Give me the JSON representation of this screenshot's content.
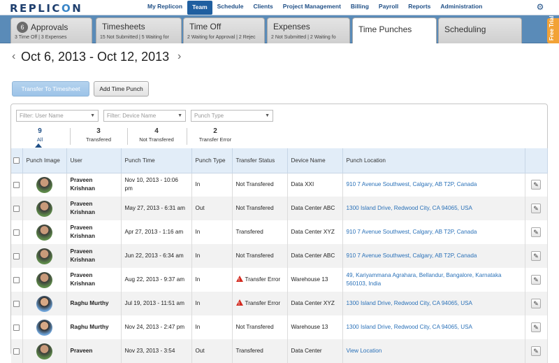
{
  "brand": {
    "logo_prefix": "REPLIC",
    "logo_o": "O",
    "logo_suffix": "N"
  },
  "nav": {
    "items": [
      "My Replicon",
      "Team",
      "Schedule",
      "Clients",
      "Project Management",
      "Billing",
      "Payroll",
      "Reports",
      "Administration"
    ],
    "active": "Team"
  },
  "tabs": [
    {
      "label": "Approvals",
      "badge": "6",
      "sub": "3 Time Off | 3 Expenses"
    },
    {
      "label": "Timesheets",
      "sub": "15 Not Submitted | 5 Waiting for"
    },
    {
      "label": "Time Off",
      "sub": "2 Waiting for Approval | 2 Rejec"
    },
    {
      "label": "Expenses",
      "sub": "2 Not Submitted | 2 Waiting fo"
    },
    {
      "label": "Time Punches",
      "sub": ""
    },
    {
      "label": "Scheduling",
      "sub": ""
    }
  ],
  "free_trial": "Free Trial",
  "date_range": "Oct 6, 2013  -  Oct 12, 2013",
  "buttons": {
    "transfer": "Transfer To Timesheet",
    "add": "Add Time Punch"
  },
  "filters": {
    "user": "Filter: User Name",
    "device": "Filter: Device Name",
    "punch_type": "Punch Type"
  },
  "counts": [
    {
      "n": "9",
      "label": "All"
    },
    {
      "n": "3",
      "label": "Transfered"
    },
    {
      "n": "4",
      "label": "Not Transfered"
    },
    {
      "n": "2",
      "label": "Transfer Error"
    }
  ],
  "columns": [
    "Punch Image",
    "User",
    "Punch Time",
    "Punch Type",
    "Transfer Status",
    "Device Name",
    "Punch Location"
  ],
  "rows": [
    {
      "user": "Praveen Krishnan",
      "time": "Nov 10, 2013 - 10:06 pm",
      "type": "In",
      "status": "Not Transfered",
      "device": "Data XXI",
      "location": "910 7 Avenue Southwest, Calgary, AB T2P, Canada",
      "avatar": "a"
    },
    {
      "user": "Praveen Krishnan",
      "time": "May 27, 2013 - 6:31 am",
      "type": "Out",
      "status": "Not Transfered",
      "device": "Data Center ABC",
      "location": "1300 Island Drive, Redwood City, CA 94065, USA",
      "avatar": "a"
    },
    {
      "user": "Praveen Krishnan",
      "time": "Apr 27, 2013 - 1:16 am",
      "type": "In",
      "status": "Transfered",
      "device": "Data Center XYZ",
      "location": "910 7 Avenue Southwest, Calgary, AB T2P, Canada",
      "avatar": "a"
    },
    {
      "user": "Praveen Krishnan",
      "time": "Jun 22, 2013 - 6:34 am",
      "type": "In",
      "status": "Not Transfered",
      "device": "Data Center ABC",
      "location": "910 7 Avenue Southwest, Calgary, AB T2P, Canada",
      "avatar": "a"
    },
    {
      "user": "Praveen Krishnan",
      "time": "Aug 22, 2013 - 9:37 am",
      "type": "In",
      "status": "Transfer Error",
      "device": "Warehouse 13",
      "location": "49, Kariyammana Agrahara, Bellandur, Bangalore, Karnataka 560103, India",
      "avatar": "a",
      "error": true
    },
    {
      "user": "Raghu Murthy",
      "time": "Jul 19, 2013 - 11:51 am",
      "type": "In",
      "status": "Transfer Error",
      "device": "Data Center XYZ",
      "location": "1300 Island Drive, Redwood City, CA 94065, USA",
      "avatar": "b",
      "error": true
    },
    {
      "user": "Raghu Murthy",
      "time": "Nov 24, 2013 - 2:47 pm",
      "type": "In",
      "status": "Not Transfered",
      "device": "Warehouse 13",
      "location": "1300 Island Drive, Redwood City, CA 94065, USA",
      "avatar": "b"
    },
    {
      "user": "Praveen",
      "time": "Nov 23, 2013 - 3:54",
      "type": "Out",
      "status": "Transfered",
      "device": "Data Center",
      "location": "View Location",
      "avatar": "a"
    }
  ],
  "colors": {
    "accent": "#1f5fa0",
    "tabstrip": "#5a8bb8",
    "link": "#2a71b8",
    "free_trial": "#f2a236",
    "error": "#d32a1f"
  }
}
